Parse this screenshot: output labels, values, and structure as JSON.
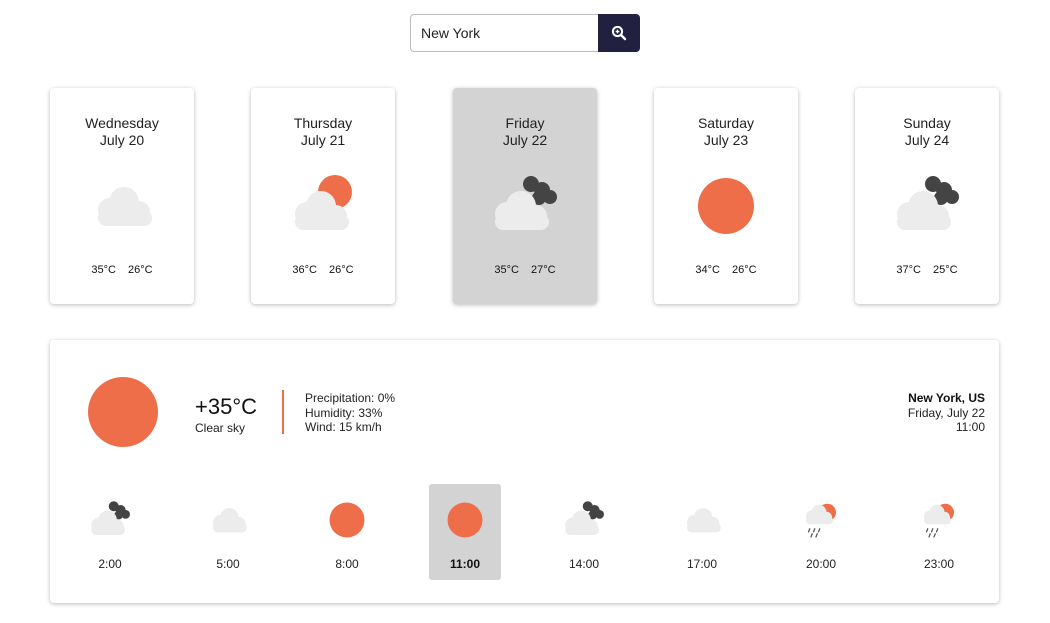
{
  "search": {
    "value": "New York",
    "button_icon": "zoom-search-icon"
  },
  "colors": {
    "accent": "#ee6e4a",
    "cloud": "#ececec",
    "dark_cloud": "#444444",
    "selected_bg": "#d3d3d3",
    "button_bg": "#222040"
  },
  "days": [
    {
      "name": "Wednesday",
      "date": "July 20",
      "icon": "cloudy",
      "high": "35°C",
      "low": "26°C",
      "active": false
    },
    {
      "name": "Thursday",
      "date": "July 21",
      "icon": "partly-sunny",
      "high": "36°C",
      "low": "26°C",
      "active": false
    },
    {
      "name": "Friday",
      "date": "July 22",
      "icon": "mixed-clouds",
      "high": "35°C",
      "low": "27°C",
      "active": true
    },
    {
      "name": "Saturday",
      "date": "July 23",
      "icon": "sunny",
      "high": "34°C",
      "low": "26°C",
      "active": false
    },
    {
      "name": "Sunday",
      "date": "July 24",
      "icon": "mixed-clouds",
      "high": "37°C",
      "low": "25°C",
      "active": false
    }
  ],
  "current": {
    "icon": "sunny",
    "temperature": "+35°C",
    "condition": "Clear sky",
    "precipitation": "Precipitation: 0%",
    "humidity": "Humidity: 33%",
    "wind": "Wind: 15 km/h",
    "location": "New York, US",
    "date": "Friday, July 22",
    "time": "11:00"
  },
  "hours": [
    {
      "time": "2:00",
      "icon": "mixed-clouds",
      "active": false
    },
    {
      "time": "5:00",
      "icon": "cloudy",
      "active": false
    },
    {
      "time": "8:00",
      "icon": "sunny",
      "active": false
    },
    {
      "time": "11:00",
      "icon": "sunny",
      "active": true
    },
    {
      "time": "14:00",
      "icon": "mixed-clouds",
      "active": false
    },
    {
      "time": "17:00",
      "icon": "cloudy",
      "active": false
    },
    {
      "time": "20:00",
      "icon": "rain-sun",
      "active": false
    },
    {
      "time": "23:00",
      "icon": "rain-sun",
      "active": false
    }
  ]
}
